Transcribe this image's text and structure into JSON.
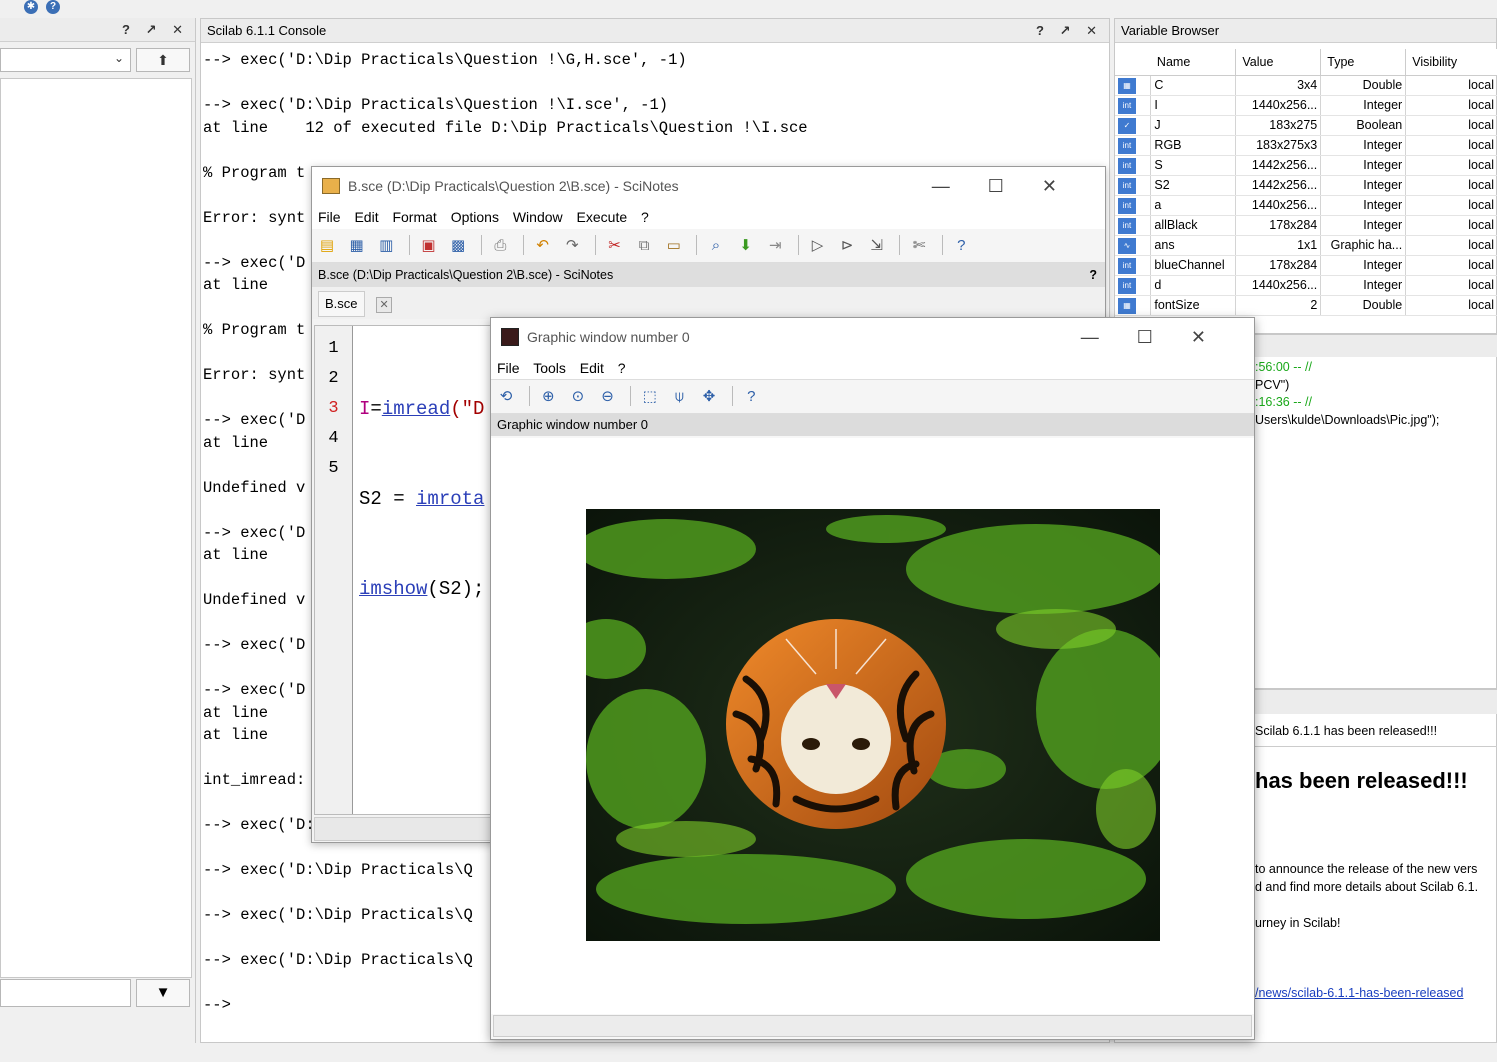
{
  "file_browser": {
    "header_controls": "? ↗ ✕"
  },
  "console": {
    "title": "Scilab 6.1.1 Console",
    "header_controls": "? ↗ ✕",
    "lines": [
      "--> exec('D:\\Dip Practicals\\Question !\\G,H.sce', -1)",
      "",
      "--> exec('D:\\Dip Practicals\\Question !\\I.sce', -1)",
      "at line    12 of executed file D:\\Dip Practicals\\Question !\\I.sce",
      "",
      "% Program t",
      "",
      "Error: synt",
      "",
      "--> exec('D",
      "at line",
      "",
      "% Program t",
      "",
      "Error: synt",
      "",
      "--> exec('D",
      "at line",
      "",
      "Undefined v",
      "",
      "--> exec('D",
      "at line",
      "",
      "Undefined v",
      "",
      "--> exec('D",
      "",
      "--> exec('D",
      "at line",
      "at line",
      "",
      "int_imread:",
      "",
      "--> exec('D:\\Dip Practicals\\Q",
      "",
      "--> exec('D:\\Dip Practicals\\Q",
      "",
      "--> exec('D:\\Dip Practicals\\Q",
      "",
      "--> exec('D:\\Dip Practicals\\Q",
      "",
      "-->"
    ]
  },
  "variable_browser": {
    "title": "Variable Browser",
    "columns": [
      "Name",
      "Value",
      "Type",
      "Visibility"
    ],
    "rows": [
      {
        "icon": "double",
        "name": "C",
        "value": "3x4",
        "type": "Double",
        "visibility": "local"
      },
      {
        "icon": "int",
        "name": "I",
        "value": "1440x256...",
        "type": "Integer",
        "visibility": "local"
      },
      {
        "icon": "bool",
        "name": "J",
        "value": "183x275",
        "type": "Boolean",
        "visibility": "local"
      },
      {
        "icon": "int",
        "name": "RGB",
        "value": "183x275x3",
        "type": "Integer",
        "visibility": "local"
      },
      {
        "icon": "int",
        "name": "S",
        "value": "1442x256...",
        "type": "Integer",
        "visibility": "local"
      },
      {
        "icon": "int",
        "name": "S2",
        "value": "1442x256...",
        "type": "Integer",
        "visibility": "local"
      },
      {
        "icon": "int",
        "name": "a",
        "value": "1440x256...",
        "type": "Integer",
        "visibility": "local"
      },
      {
        "icon": "int",
        "name": "allBlack",
        "value": "178x284",
        "type": "Integer",
        "visibility": "local"
      },
      {
        "icon": "graphic",
        "name": "ans",
        "value": "1x1",
        "type": "Graphic ha...",
        "visibility": "local"
      },
      {
        "icon": "int",
        "name": "blueChannel",
        "value": "178x284",
        "type": "Integer",
        "visibility": "local"
      },
      {
        "icon": "int",
        "name": "d",
        "value": "1440x256...",
        "type": "Integer",
        "visibility": "local"
      },
      {
        "icon": "double",
        "name": "fontSize",
        "value": "2",
        "type": "Double",
        "visibility": "local"
      }
    ]
  },
  "history": {
    "lines": [
      ":56:00 -- //",
      "PCV\")",
      ":16:36 -- //",
      "Users\\kulde\\Downloads\\Pic.jpg\");"
    ]
  },
  "news": {
    "tab_label": "Scilab 6.1.1 has been released!!!",
    "heading": "has been released!!!",
    "para1_line1": "to announce the release of the new vers",
    "para1_line2": "d and find more details about Scilab 6.1.",
    "para2": "urney in Scilab!",
    "link": "/news/scilab-6.1.1-has-been-released"
  },
  "scinotes": {
    "title": "B.sce (D:\\Dip Practicals\\Question 2\\B.sce) - SciNotes",
    "menu": [
      "File",
      "Edit",
      "Format",
      "Options",
      "Window",
      "Execute",
      "?"
    ],
    "subtitle": "B.sce (D:\\Dip Practicals\\Question 2\\B.sce) - SciNotes",
    "help_mark": "?",
    "tab_label": "B.sce",
    "line_numbers": [
      "1",
      "2",
      "3",
      "4",
      "5"
    ],
    "code": {
      "line1_var": "I",
      "line1_eq": "=",
      "line1_fn": "imread",
      "line1_rest": "(\"D",
      "line2_var": "S2",
      "line2_eq": " = ",
      "line2_fn": "imrota",
      "line3_fn": "imshow",
      "line3_rest": "(S2);"
    }
  },
  "graphic_window": {
    "title": "Graphic window number 0",
    "menu": [
      "File",
      "Tools",
      "Edit",
      "?"
    ],
    "subtitle": "Graphic window number 0"
  }
}
